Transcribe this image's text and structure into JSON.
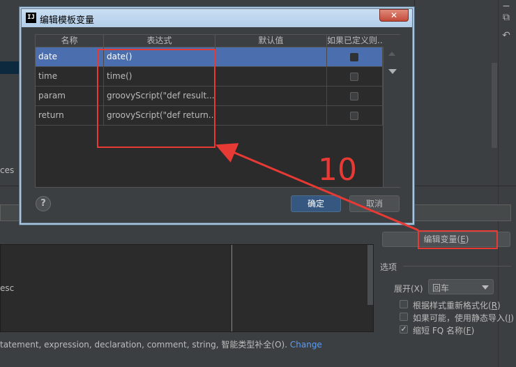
{
  "background": {
    "left_text_1": "ces",
    "left_text_2": "esc",
    "edit_vars_button": "编辑变量(",
    "edit_vars_mnemonic": "E",
    "edit_vars_suffix": ")",
    "options_label": "选项",
    "expand_label": "展开(X)",
    "expand_value": "回车",
    "option1_pre": "根据样式重新格式化(",
    "option1_m": "R",
    "option1_post": ")",
    "option2_pre": "如果可能，使用静态导入(",
    "option2_m": "I",
    "option2_post": ")",
    "option3_pre": "缩短 FQ 名称(",
    "option3_m": "F",
    "option3_post": ")",
    "status_text": "tatement, expression, declaration, comment, string, 智能类型补全(O).",
    "status_link": "Change"
  },
  "dialog": {
    "icon_text": "IJ",
    "title": "编辑模板变量",
    "close": "✕",
    "columns": [
      "名称",
      "表达式",
      "默认值",
      "如果已定义则..."
    ],
    "rows": [
      {
        "name": "date",
        "expression": "date()",
        "default": "",
        "checked": false,
        "selected": true
      },
      {
        "name": "time",
        "expression": "time()",
        "default": "",
        "checked": false,
        "selected": false
      },
      {
        "name": "param",
        "expression": "groovyScript(\"def result...",
        "default": "",
        "checked": false,
        "selected": false
      },
      {
        "name": "return",
        "expression": "groovyScript(\"def return...",
        "default": "",
        "checked": false,
        "selected": false
      }
    ],
    "help": "?",
    "ok_label": "确定",
    "cancel_label": "取消"
  },
  "annotation": {
    "number": "10",
    "color": "#e83a35"
  }
}
